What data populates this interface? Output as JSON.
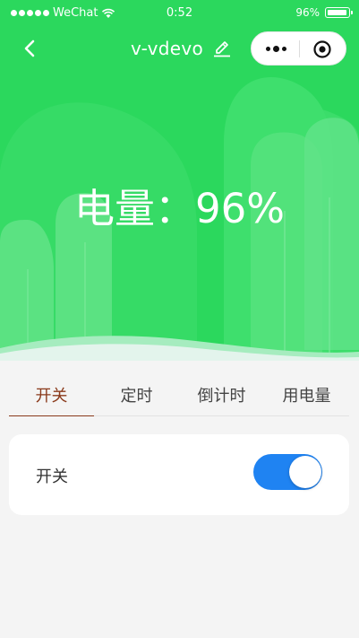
{
  "status_bar": {
    "carrier": "WeChat",
    "time": "0:52",
    "battery": "96%",
    "battery_level": 0.96
  },
  "nav": {
    "title": "v-vdevo"
  },
  "hero": {
    "battery_text": "电量：96%"
  },
  "tabs": [
    {
      "label": "开关",
      "active": true
    },
    {
      "label": "定时",
      "active": false
    },
    {
      "label": "倒计时",
      "active": false
    },
    {
      "label": "用电量",
      "active": false
    }
  ],
  "switch_card": {
    "label": "开关",
    "on": true
  },
  "colors": {
    "hero_green": "#2bd85d",
    "tab_active": "#8a3a1b",
    "toggle_on": "#1f83f2"
  },
  "icons": [
    "wifi-icon",
    "battery-icon",
    "back-chevron-icon",
    "edit-pencil-icon",
    "more-dots-icon",
    "close-target-icon"
  ]
}
